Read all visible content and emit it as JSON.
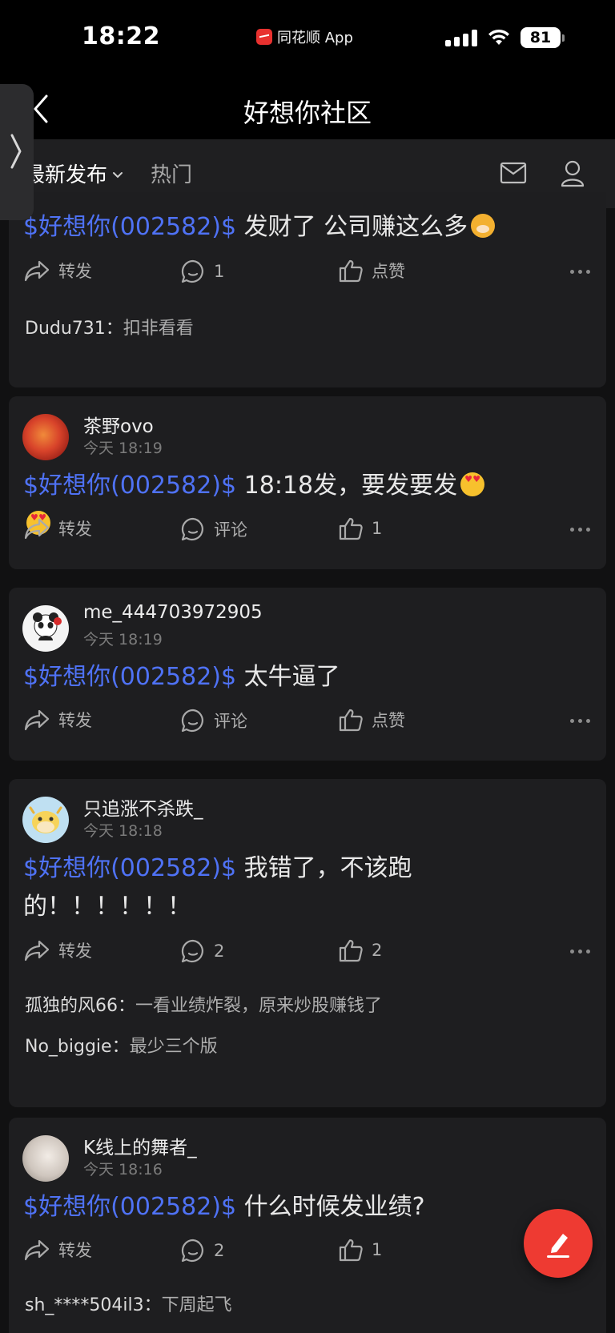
{
  "status_bar": {
    "time": "18:22",
    "app_name": "同花顺 App",
    "battery": "81"
  },
  "nav": {
    "title": "好想你社区"
  },
  "tabs": {
    "latest": "最新发布",
    "hot": "热门"
  },
  "posts": [
    {
      "stock": "$好想你(002582)$",
      "text": " 发财了 公司赚这么多",
      "share": "转发",
      "comment": "1",
      "like": "点赞",
      "comments": [
        {
          "user": "Dudu731：",
          "text": "扣非看看"
        }
      ]
    },
    {
      "user": "茶野ovo",
      "time": "今天 18:19",
      "stock": "$好想你(002582)$",
      "text": " 18:18发，要发要发",
      "share": "转发",
      "comment": "评论",
      "like": "1"
    },
    {
      "user": "me_444703972905",
      "time": "今天 18:19",
      "stock": "$好想你(002582)$",
      "text": " 太牛逼了",
      "share": "转发",
      "comment": "评论",
      "like": "点赞"
    },
    {
      "user": "只追涨不杀跌_",
      "time": "今天 18:18",
      "stock": "$好想你(002582)$",
      "text": " 我错了，不该跑",
      "text2": "的！！！！！！",
      "share": "转发",
      "comment": "2",
      "like": "2",
      "comments": [
        {
          "user": "孤独的风66：",
          "text": "一看业绩炸裂，原来炒股赚钱了"
        },
        {
          "user": "No_biggie：",
          "text": "最少三个版"
        }
      ]
    },
    {
      "user": "K线上的舞者_",
      "time": "今天 18:16",
      "stock": "$好想你(002582)$",
      "text": " 什么时候发业绩?",
      "share": "转发",
      "comment": "2",
      "like": "1",
      "comments": [
        {
          "user": "sh_****504il3：",
          "text": "下周起飞"
        }
      ]
    }
  ],
  "colors": {
    "accent": "#e0262e",
    "stock_link": "#4f72f5",
    "fab": "#ee3a32"
  },
  "icons": [
    "back-icon",
    "chevron-right-icon",
    "chevron-down-icon",
    "mail-icon",
    "user-icon",
    "share-icon",
    "comment-icon",
    "like-icon",
    "more-icon",
    "edit-icon"
  ]
}
